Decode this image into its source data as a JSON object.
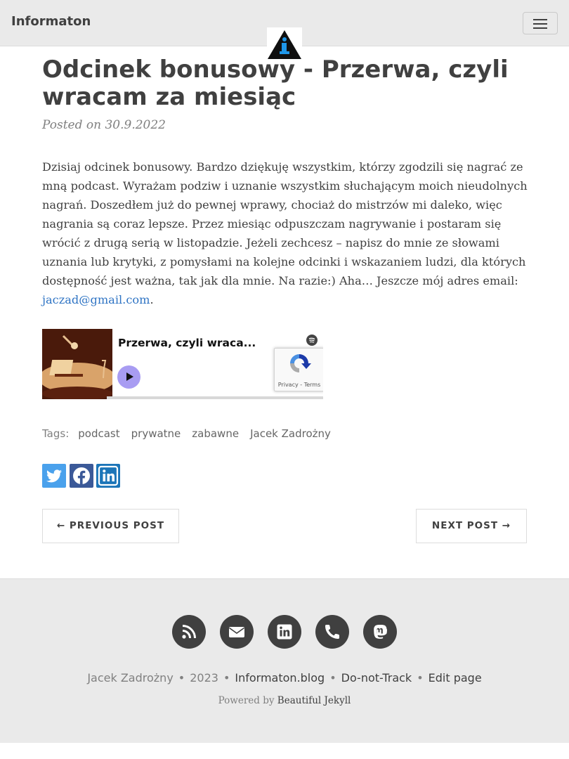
{
  "navbar": {
    "brand": "Informaton",
    "menu_icon": "hamburger-menu-icon",
    "logo_icon": "info-triangle-logo-icon"
  },
  "post": {
    "title": "Odcinek bonusowy - Przerwa, czyli wracam za miesiąc",
    "meta": "Posted on 30.9.2022",
    "body_text": "Dzisiaj odcinek bonusowy. Bardzo dziękuję wszystkim, którzy zgodzili się nagrać ze mną podcast. Wyrażam podziw i uznanie wszystkim słuchającym moich nieudolnych nagrań. Doszedłem już do pewnej wprawy, chociaż do mistrzów mi daleko, więc nagrania są coraz lepsze. Przez miesiąc odpuszczam nagrywanie i postaram się wrócić z drugą serią w listopadzie. Jeżeli zechcesz – napisz do mnie ze słowami uznania lub krytyki, z pomysłami na kolejne odcinki i wskazaniem ludzi, dla których dostępność jest ważna, tak jak dla mnie. Na razie:) Aha… Jeszcze mój adres email: ",
    "email": "jaczad@gmail.com",
    "body_end": "."
  },
  "embed": {
    "title": "Przerwa, czyli wraca...",
    "recaptcha_links": "Privacy - Terms",
    "play_icon": "play-icon",
    "spotify_icon": "spotify-icon"
  },
  "tags": {
    "label": "Tags:",
    "items": [
      "podcast",
      "prywatne",
      "zabawne",
      "Jacek Zadrożny"
    ]
  },
  "share": {
    "twitter": {
      "icon": "twitter-icon",
      "color": "#4aa1ec"
    },
    "facebook": {
      "icon": "facebook-icon",
      "color": "#3b5998"
    },
    "linkedin": {
      "icon": "linkedin-icon",
      "color": "#1c75b8"
    }
  },
  "pager": {
    "previous": "← PREVIOUS POST",
    "next": "NEXT POST →"
  },
  "footer": {
    "icons": [
      "rss-icon",
      "envelope-icon",
      "linkedin-icon",
      "phone-icon",
      "mastodon-icon"
    ],
    "author": "Jacek Zadrożny",
    "year": "2023",
    "site": "Informaton.blog",
    "dnt": "Do-not-Track",
    "edit": "Edit page",
    "separator": "•",
    "powered_by": "Powered by",
    "theme": "Beautiful Jekyll"
  },
  "colors": {
    "nav_bg": "#eaeaea",
    "text": "#404040",
    "link": "#2f74c4",
    "muted": "#808080"
  }
}
